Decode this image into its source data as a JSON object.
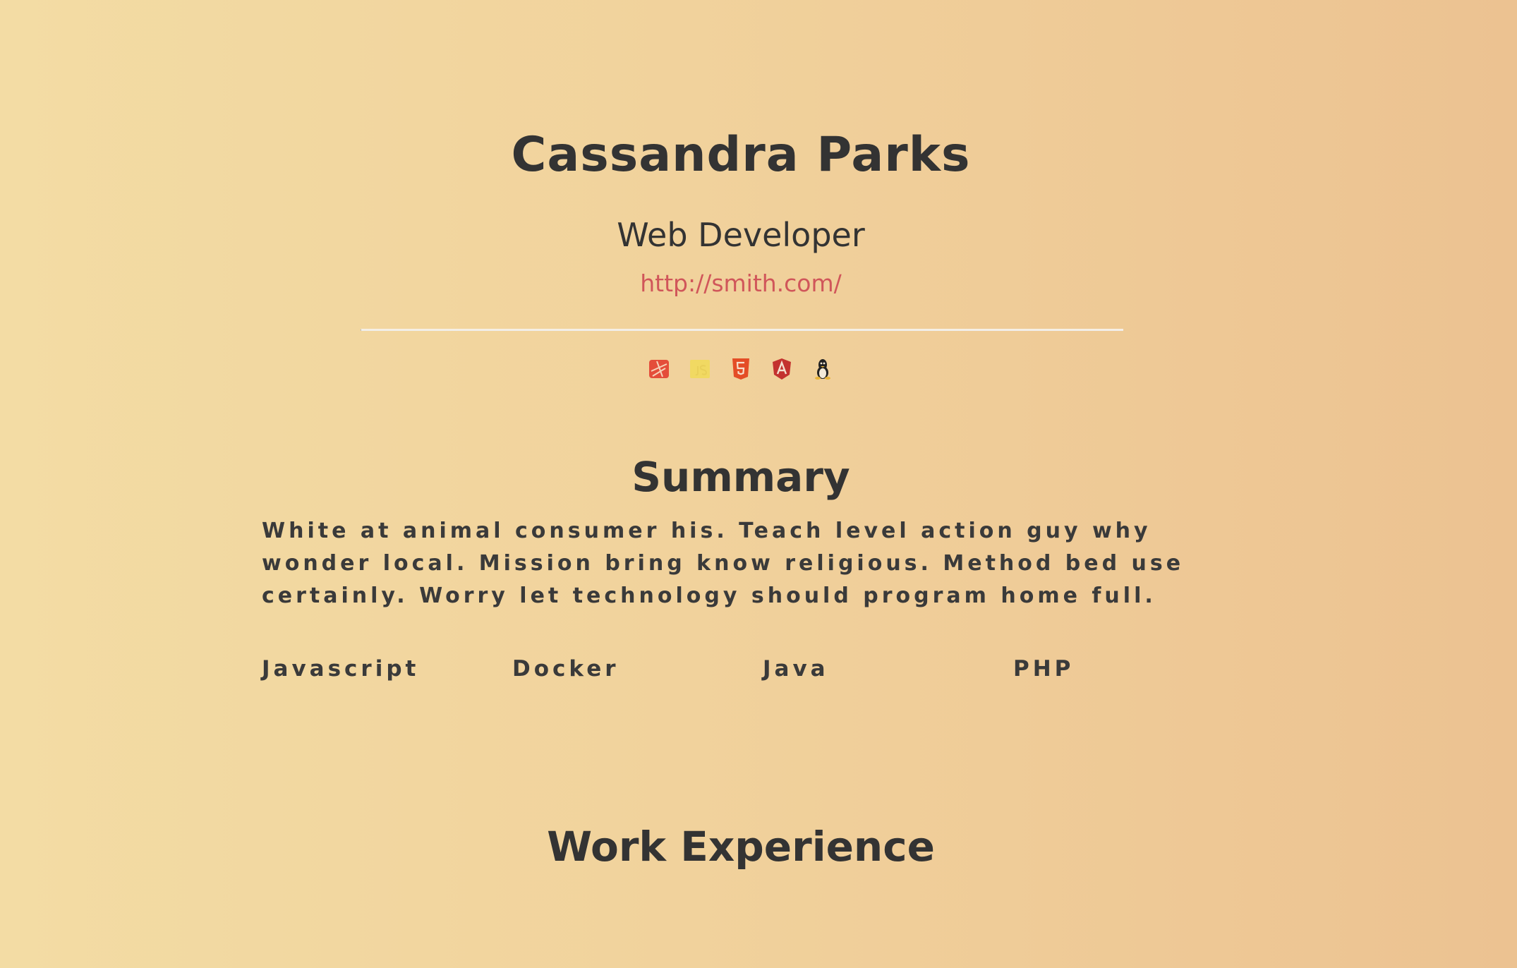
{
  "header": {
    "name": "Cassandra Parks",
    "role": "Web Developer",
    "website": "http://smith.com/"
  },
  "profiles": [
    {
      "icon": "laravel-icon",
      "color": "#e44d3a"
    },
    {
      "icon": "javascript-icon",
      "color": "#f0db4f"
    },
    {
      "icon": "html5-icon",
      "color": "#e44d26"
    },
    {
      "icon": "angular-icon",
      "color": "#c3322f"
    },
    {
      "icon": "linux-icon",
      "color": "#333333"
    }
  ],
  "summary": {
    "title": "Summary",
    "text": "White at animal consumer his. Teach level action guy why wonder local. Mission bring know religious. Method bed use certainly. Worry let technology should program home full."
  },
  "skills": [
    "Javascript",
    "Docker",
    "Java",
    "PHP"
  ],
  "work": {
    "title": "Work Experience"
  },
  "colors": {
    "text": "#333333",
    "link": "#d0565a",
    "background_start": "#f3dca4",
    "background_end": "#ecc291"
  }
}
